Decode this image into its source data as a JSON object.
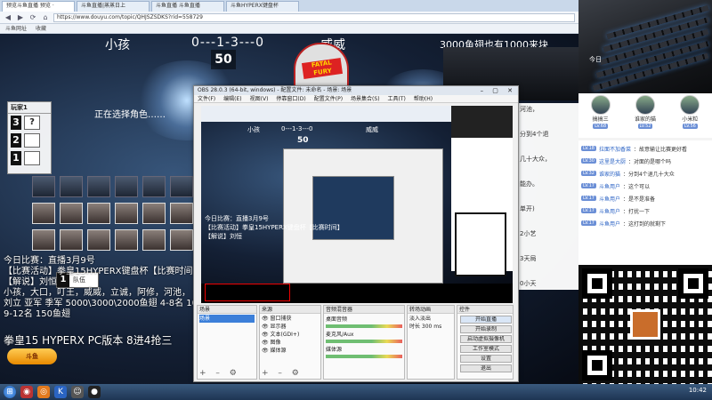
{
  "browser": {
    "tabs": [
      "预览斗鱼直播 预览 ·",
      "斗鱼直播|蒸蒸日上",
      "斗鱼直播 斗鱼直播",
      "斗鱼HYPERX键盘杯"
    ],
    "url": "https://www.douyu.com/topic/QHJSZSDKS?rid=558729",
    "favorites": [
      "斗鱼网址",
      "收藏"
    ]
  },
  "stream": {
    "player1": "小孩",
    "score": "0---1-3---0",
    "player2": "威威",
    "bounty": "3000鱼翅也有1000来块",
    "timer": "50",
    "cap_text": "FATAL FURY",
    "status": "正在选择角色……",
    "player_panel_title": "玩家1",
    "player_panel_q": "?",
    "ranks": [
      "3",
      "2",
      "1"
    ],
    "team_num": "1",
    "team_label": "队伍",
    "lines": [
      "今日比赛：直播3月9号",
      "【比赛活动】拳皇15HYPERX键盘杯【比赛时间】",
      "【解说】刘恒",
      "小孩，大口，叮王，威威，立诚，阿修，河池，",
      "刘立 亚军 季军 5000\\3000\\2000鱼翅 4-8名 10",
      "9-12名 150鱼翅"
    ],
    "ticker": "拳皇15 HYPERX PC版本 8进4抢三",
    "badge": "斗鱼",
    "chat_snips": [
      "河池，",
      "分到4个退",
      "几十大众，",
      "能办。",
      "单开)",
      "2小艺",
      "3天局",
      "0小天"
    ]
  },
  "obs": {
    "title": "OBS 28.0.3 (64-bit, windows) - 配置文件: 未命名 - 场景: 场景",
    "menu": [
      "文件(F)",
      "编辑(E)",
      "视图(V)",
      "停靠窗口(D)",
      "配置文件(P)",
      "场景集合(S)",
      "工具(T)",
      "帮助(H)"
    ],
    "panels": {
      "scenes": {
        "header": "场景",
        "items": [
          "场景"
        ]
      },
      "sources": {
        "header": "来源",
        "items": [
          "窗口捕获",
          "显示器",
          "文本(GDI+)",
          "图像",
          "媒体源"
        ]
      },
      "mixer": {
        "header": "音频混音器",
        "items": [
          "桌面音频",
          "麦克风/Aux",
          "媒体源"
        ]
      },
      "transitions": {
        "header": "转场动画",
        "items": [
          "淡入淡出",
          "时长 300 ms"
        ]
      },
      "controls": {
        "header": "控件",
        "items": [
          "开始直播",
          "开始录制",
          "启动虚拟摄像机",
          "工作室模式",
          "设置",
          "退出"
        ]
      }
    }
  },
  "sidebar": {
    "today": "今日",
    "top_users": [
      {
        "name": "搞搞三",
        "lv": "LV.68"
      },
      {
        "name": "谁家的猫",
        "lv": "LV.52"
      },
      {
        "name": "小米粒",
        "lv": "LV.56"
      }
    ],
    "chat": [
      {
        "lv": "LV.18",
        "user": "拉面不加香菜",
        "msg": "：故意输让比赛更好看"
      },
      {
        "lv": "LV.30",
        "user": "这里是大厨",
        "msg": "：对面的是哪个吗"
      },
      {
        "lv": "LV.32",
        "user": "谁家的猫",
        "msg": "：分到4个退几十大众"
      },
      {
        "lv": "LV.17",
        "user": "斗鱼用户",
        "msg": "：这个可以"
      },
      {
        "lv": "LV.17",
        "user": "斗鱼用户",
        "msg": "：是不是准备"
      },
      {
        "lv": "LV.17",
        "user": "斗鱼用户",
        "msg": "：打扰一下"
      },
      {
        "lv": "LV.17",
        "user": "斗鱼用户",
        "msg": "：这打到的就剩下"
      }
    ]
  },
  "taskbar": {
    "clock": "10:42"
  },
  "colors": {
    "stream_bg": "#142035",
    "accent": "#3c7fd9",
    "level_badge": "#6b8fd6",
    "taskbar": "#1e3553"
  }
}
